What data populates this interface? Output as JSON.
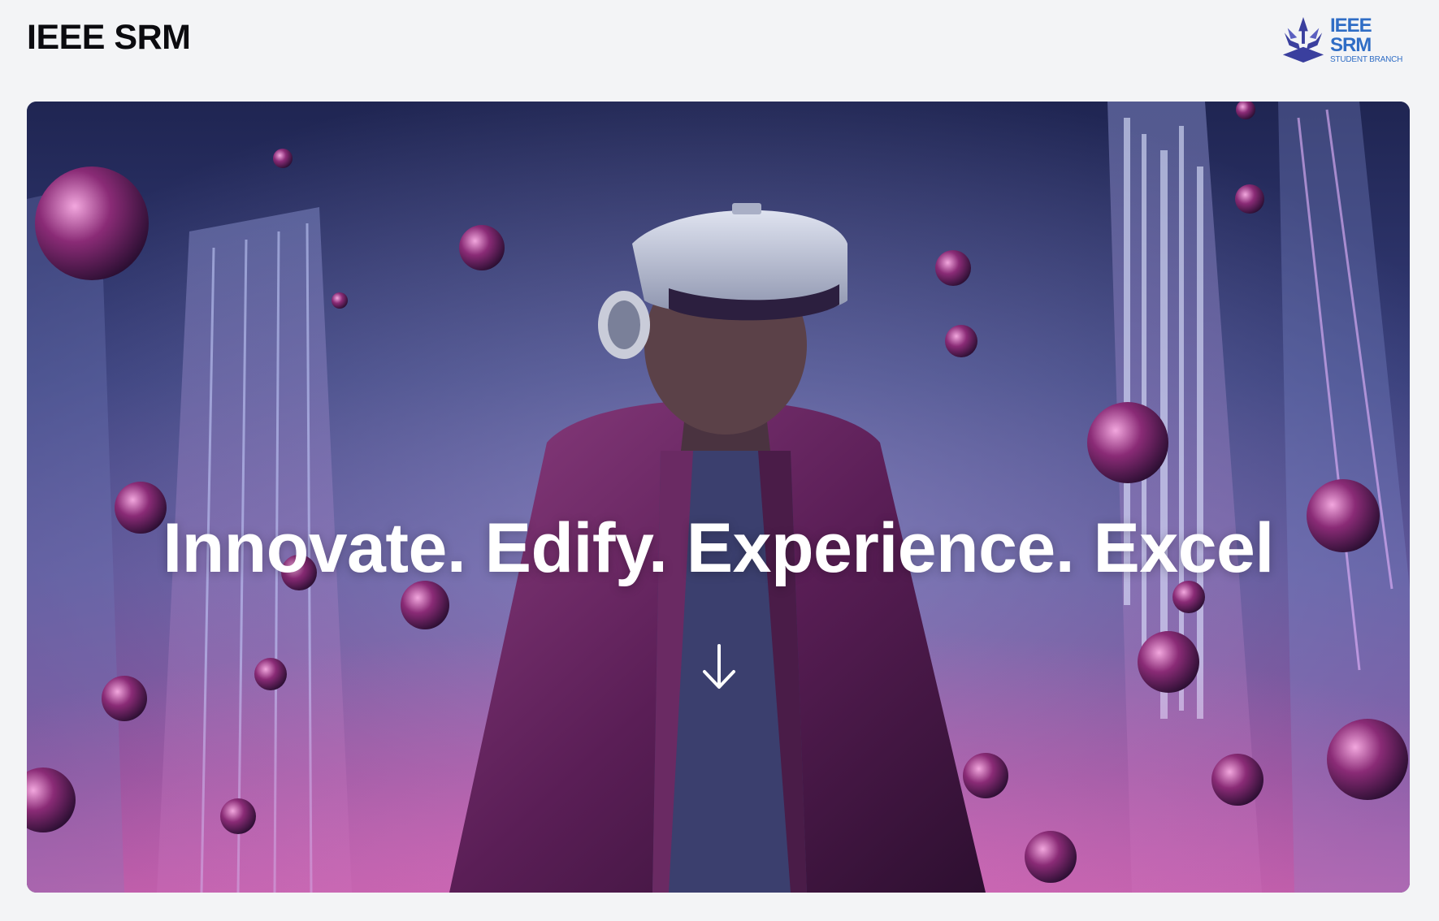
{
  "header": {
    "site_title": "IEEE SRM",
    "logo": {
      "name": "IEEE SRM",
      "subtitle": "STUDENT BRANCH"
    }
  },
  "hero": {
    "headline": "Innovate. Edify. Experience. Excel",
    "background_image": "person-wearing-vr-headset-in-neon-city-icon",
    "scroll_icon": "arrow-down-icon"
  },
  "colors": {
    "page_background": "#f3f4f6",
    "title_text": "#0b0b0f",
    "logo_blue": "#2f6dc5",
    "hero_text": "#ffffff",
    "hero_deep_blue": "#232a5c",
    "hero_magenta": "#c0479a"
  }
}
